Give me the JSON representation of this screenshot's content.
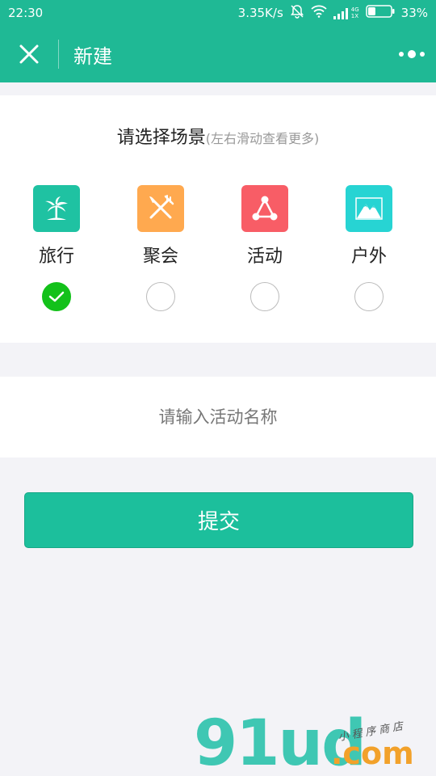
{
  "status_bar": {
    "time": "22:30",
    "speed": "3.35K/s",
    "network": "4G",
    "network_sub": "1X",
    "battery": "33%",
    "battery_level": 0.33
  },
  "nav": {
    "close_icon": "close-icon",
    "title": "新建",
    "more_icon": "more-dots-icon"
  },
  "scene": {
    "heading": "请选择场景",
    "hint": "(左右滑动查看更多)",
    "items": [
      {
        "label": "旅行",
        "icon": "palm-tree-icon",
        "color": "#1fc2a2",
        "checked": true
      },
      {
        "label": "聚会",
        "icon": "fork-knife-icon",
        "color": "#ffa94f",
        "checked": false
      },
      {
        "label": "活动",
        "icon": "network-icon",
        "color": "#f85d66",
        "checked": false
      },
      {
        "label": "户外",
        "icon": "mountain-icon",
        "color": "#27d4d3",
        "checked": false
      }
    ]
  },
  "activity_name": {
    "placeholder": "请输入活动名称",
    "value": ""
  },
  "submit": {
    "label": "提交"
  },
  "watermark": {
    "logo": "91ud",
    "domain": ".com",
    "tagline": "小程序商店"
  },
  "colors": {
    "brand": "#1fb995",
    "button": "#1cbf9c",
    "check": "#13c11a",
    "background": "#f3f3f7"
  }
}
